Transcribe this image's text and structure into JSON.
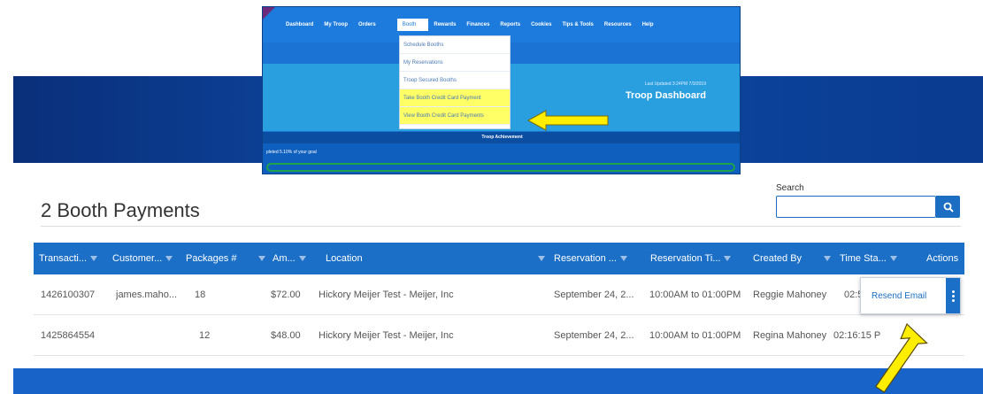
{
  "inset": {
    "nav": [
      "Dashboard",
      "My Troop",
      "Orders",
      "Booth",
      "Rewards",
      "Finances",
      "Reports",
      "Cookies",
      "Tips & Tools",
      "Resources",
      "Help"
    ],
    "active_nav_index": 3,
    "dropdown": [
      "Schedule Booths",
      "My Reservations",
      "Troop Secured Booths",
      "Take Booth Credit Card Payment",
      "View Booth Credit Card Payments"
    ],
    "highlighted_dropdown_indexes": [
      3,
      4
    ],
    "updated_text": "Last Updated 3:24PM 7/3/2019",
    "title": "Troop Dashboard",
    "achievement_label": "Troop Achievement",
    "goal_text": "pleted 5.10% of your goal"
  },
  "page": {
    "heading": "2 Booth Payments",
    "search_label": "Search",
    "search_value": ""
  },
  "table": {
    "headers": [
      "Transacti...",
      "Customer...",
      "Packages #",
      "Am...",
      "Location",
      "Reservation ...",
      "Reservation Ti...",
      "Created By",
      "Time Sta...",
      "Actions"
    ],
    "rows": [
      [
        "1426100307",
        "james.maho...",
        "18",
        "$72.00",
        "Hickory Meijer Test - Meijer, Inc",
        "September 24, 2...",
        "10:00AM to 01:00PM",
        "Reggie Mahoney",
        "02:5",
        ""
      ],
      [
        "1425864554",
        "",
        "12",
        "$48.00",
        "Hickory Meijer Test - Meijer, Inc",
        "September 24, 2...",
        "10:00AM to 01:00PM",
        "Regina Mahoney",
        "02:16:15 P",
        ""
      ]
    ]
  },
  "actions_menu": {
    "item": "Resend Email"
  },
  "colors": {
    "header_blue": "#1b6fc7",
    "highlight_yellow": "#ffff66",
    "annotation_arrow": "#ffee00"
  }
}
